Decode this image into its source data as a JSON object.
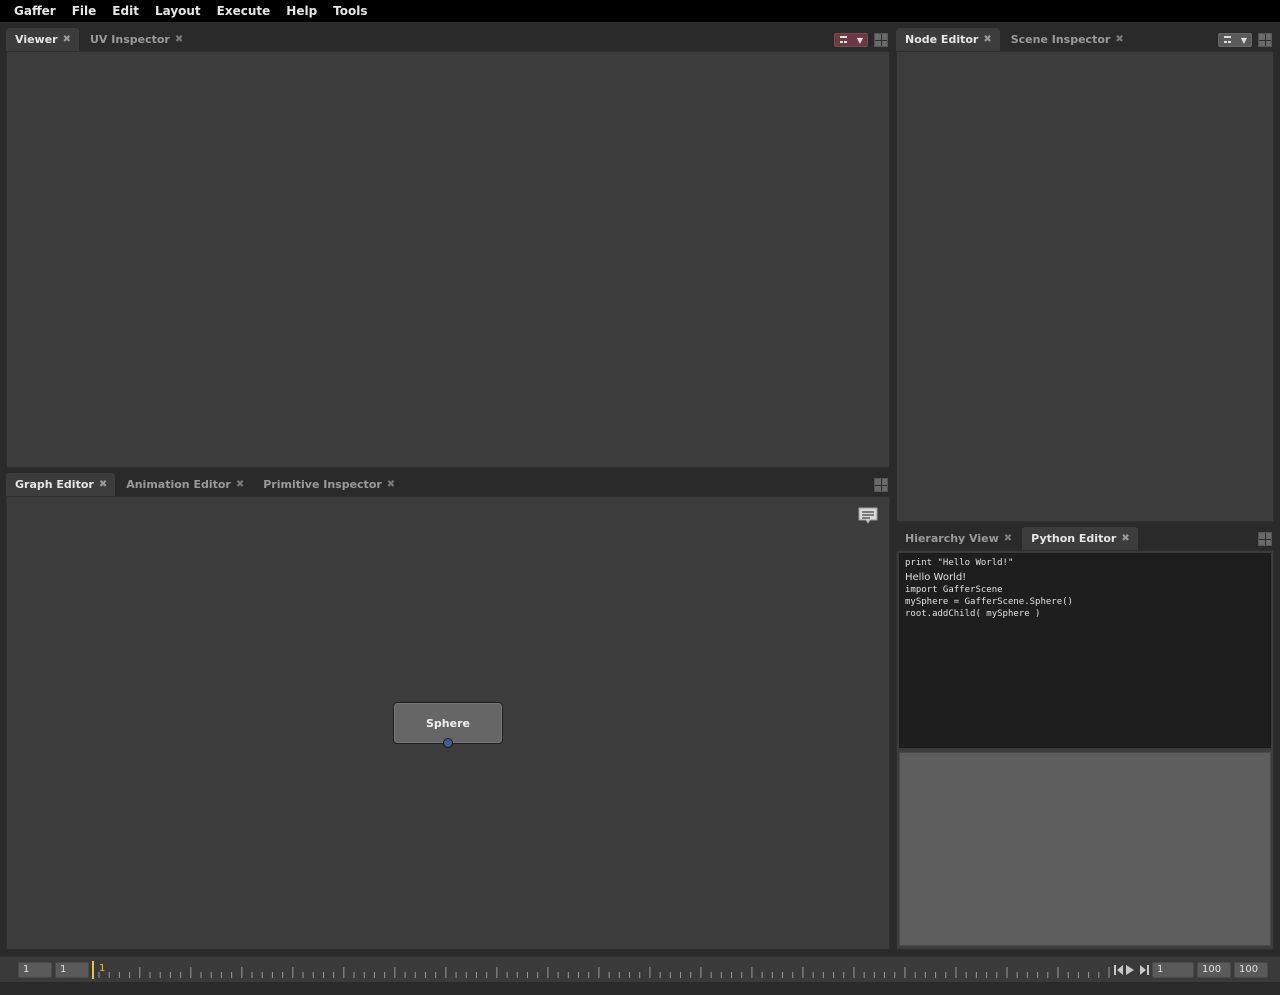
{
  "app": {
    "name": "Gaffer"
  },
  "menubar": {
    "items": [
      "Gaffer",
      "File",
      "Edit",
      "Layout",
      "Execute",
      "Help",
      "Tools"
    ]
  },
  "viewer_panel": {
    "tabs": [
      {
        "label": "Viewer",
        "active": true
      },
      {
        "label": "UV Inspector",
        "active": false
      }
    ]
  },
  "node_editor_panel": {
    "tabs": [
      {
        "label": "Node Editor",
        "active": true
      },
      {
        "label": "Scene Inspector",
        "active": false
      }
    ]
  },
  "graph_panel": {
    "tabs": [
      {
        "label": "Graph Editor",
        "active": true
      },
      {
        "label": "Animation Editor",
        "active": false
      },
      {
        "label": "Primitive Inspector",
        "active": false
      }
    ],
    "node": {
      "label": "Sphere"
    }
  },
  "python_panel": {
    "tabs": [
      {
        "label": "Hierarchy View",
        "active": false
      },
      {
        "label": "Python Editor",
        "active": true
      }
    ],
    "output_line1": "print \"Hello World!\"",
    "output_result": "Hello World!",
    "output_line2": "import GafferScene",
    "output_line3": "mySphere = GafferScene.Sphere()",
    "output_line4": "root.addChild( mySphere )"
  },
  "timeline": {
    "start": "1",
    "range_start": "1",
    "current_frame": "1",
    "frame_field": "1",
    "range_end": "100",
    "end": "100"
  },
  "colors": {
    "menubar_bg": "#000000",
    "panel_bg": "#3c3c3c",
    "node_bg": "#666666",
    "plug": "#3e5d8e",
    "timeline_cursor": "#e0c640",
    "mode_btn_viewer": "#6b3a40",
    "mode_btn_node": "#5a5a5a"
  },
  "icons": {
    "tab_close": "close-icon",
    "layout": "layout-grid-icon",
    "annotation": "annotation-icon",
    "play": "play-icon",
    "skip_start": "skip-start-icon",
    "skip_end": "skip-end-icon"
  }
}
